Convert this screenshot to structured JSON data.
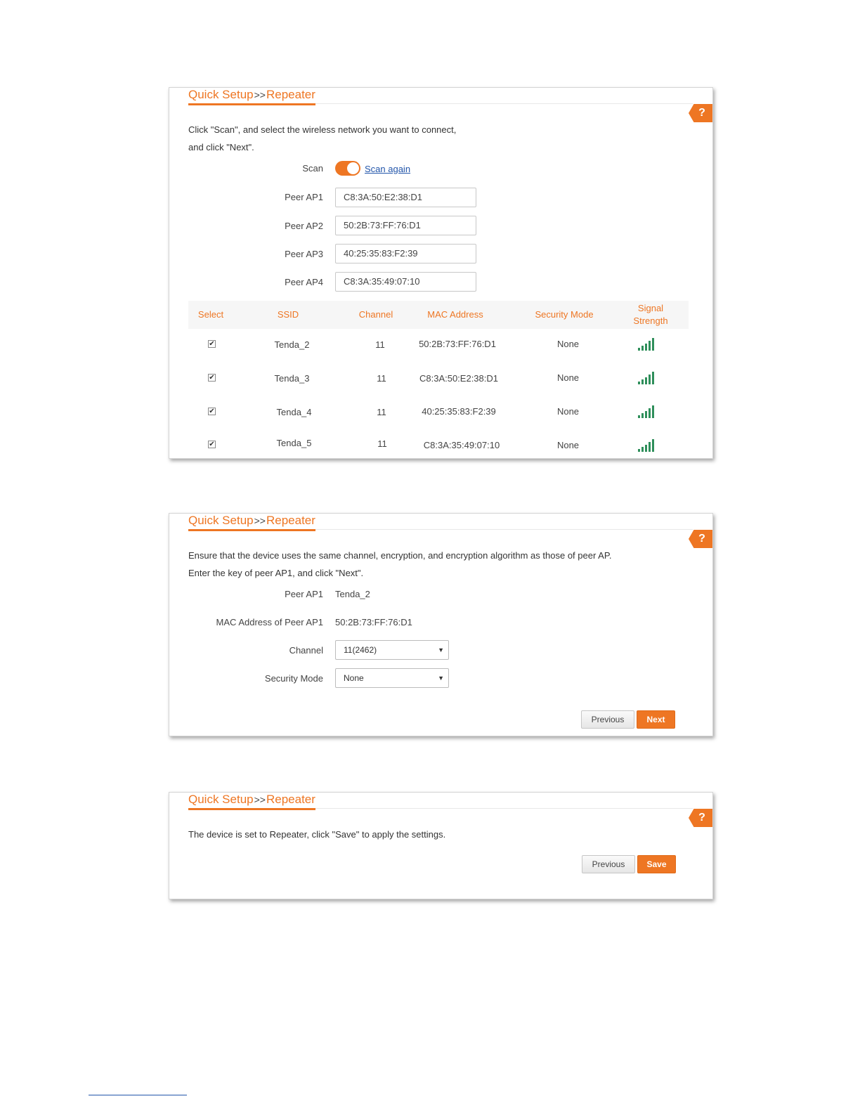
{
  "breadcrumb": {
    "parent": "Quick Setup",
    "separator": ">>",
    "current": "Repeater"
  },
  "help_label": "?",
  "scan_panel": {
    "instruction_line1": "Click \"Scan\", and select the wireless network you want to connect,",
    "instruction_line2": "and click \"Next\".",
    "scan_label": "Scan",
    "scan_toggle_on": true,
    "scan_again_label": "Scan again",
    "peer_aps": [
      {
        "label": "Peer AP1",
        "value": "C8:3A:50:E2:38:D1"
      },
      {
        "label": "Peer AP2",
        "value": "50:2B:73:FF:76:D1"
      },
      {
        "label": "Peer AP3",
        "value": "40:25:35:83:F2:39"
      },
      {
        "label": "Peer AP4",
        "value": "C8:3A:35:49:07:10"
      }
    ],
    "table": {
      "headers": {
        "select": "Select",
        "ssid": "SSID",
        "channel": "Channel",
        "mac": "MAC Address",
        "security": "Security Mode",
        "signal_line1": "Signal",
        "signal_line2": "Strength"
      },
      "rows": [
        {
          "checked": true,
          "ssid": "Tenda_2",
          "channel": "11",
          "mac": "50:2B:73:FF:76:D1",
          "security": "None",
          "signal_bars": 5
        },
        {
          "checked": true,
          "ssid": "Tenda_3",
          "channel": "11",
          "mac": "C8:3A:50:E2:38:D1",
          "security": "None",
          "signal_bars": 5
        },
        {
          "checked": true,
          "ssid": "Tenda_4",
          "channel": "11",
          "mac": "40:25:35:83:F2:39",
          "security": "None",
          "signal_bars": 5
        },
        {
          "checked": true,
          "ssid": "Tenda_5",
          "channel": "11",
          "mac": "C8:3A:35:49:07:10",
          "security": "None",
          "signal_bars": 5
        }
      ]
    }
  },
  "config_panel": {
    "instruction_line1": "Ensure that the device uses the same channel, encryption, and encryption algorithm as those of peer AP.",
    "instruction_line2": "Enter the key of peer AP1, and click \"Next\".",
    "peer_ap1_label": "Peer AP1",
    "peer_ap1_value": "Tenda_2",
    "mac_label": "MAC Address of Peer AP1",
    "mac_value": "50:2B:73:FF:76:D1",
    "channel_label": "Channel",
    "channel_value": "11(2462)",
    "security_label": "Security Mode",
    "security_value": "None",
    "previous_label": "Previous",
    "next_label": "Next"
  },
  "save_panel": {
    "message": "The device is set to Repeater, click \"Save\" to apply the settings.",
    "previous_label": "Previous",
    "save_label": "Save"
  },
  "colors": {
    "accent": "#ee7623",
    "signal": "#2f8f5b",
    "link": "#2255aa"
  }
}
